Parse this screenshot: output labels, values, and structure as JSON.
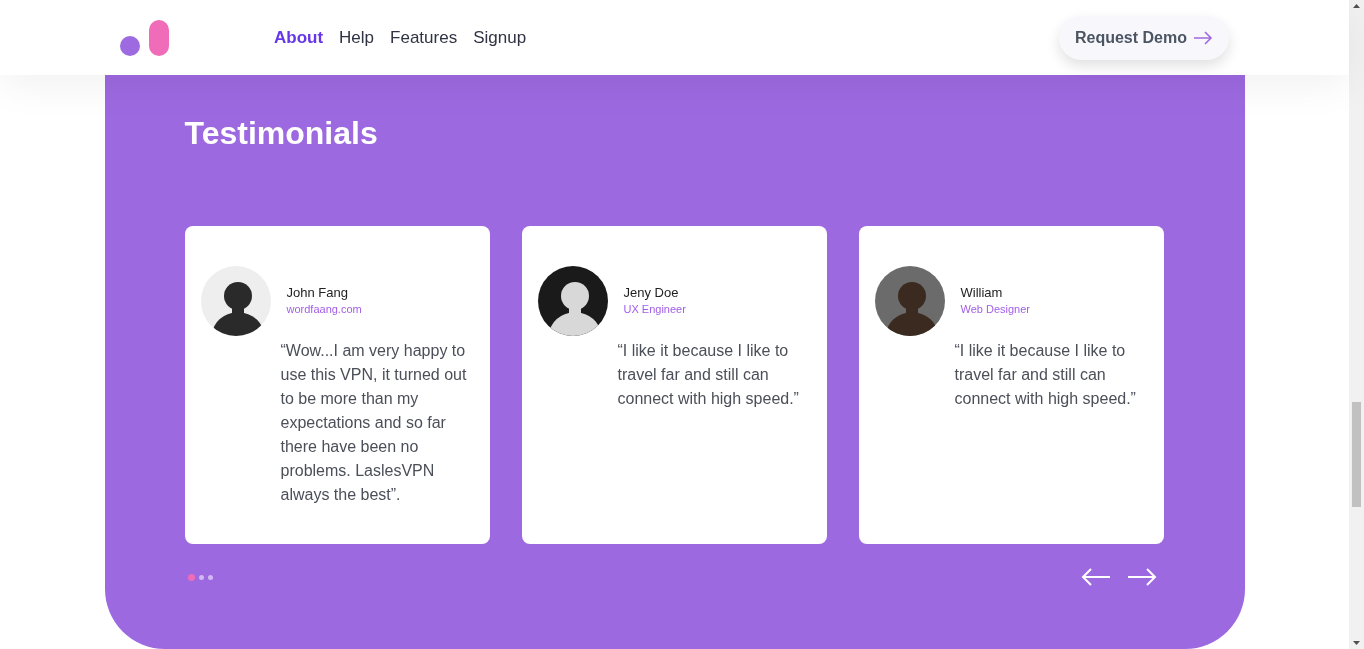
{
  "nav": {
    "links": [
      {
        "label": "About",
        "selected": true
      },
      {
        "label": "Help",
        "selected": false
      },
      {
        "label": "Features",
        "selected": false
      },
      {
        "label": "Signup",
        "selected": false
      }
    ],
    "cta": "Request Demo"
  },
  "testimonials": {
    "title": "Testimonials",
    "cards": [
      {
        "name": "John Fang",
        "role": "wordfaang.com",
        "quote": "“Wow...I am very happy to use this VPN, it turned out to be more than my expectations and so far there have been no problems. LaslesVPN always the best”."
      },
      {
        "name": "Jeny Doe",
        "role": "UX Engineer",
        "quote": "“I like it because I like to travel far and still can connect with high speed.”"
      },
      {
        "name": "William",
        "role": "Web Designer",
        "quote": "“I like it because I like to travel far and still can connect with high speed.”"
      }
    ],
    "dots": [
      {
        "selected": true
      },
      {
        "selected": false
      },
      {
        "selected": false
      }
    ]
  }
}
